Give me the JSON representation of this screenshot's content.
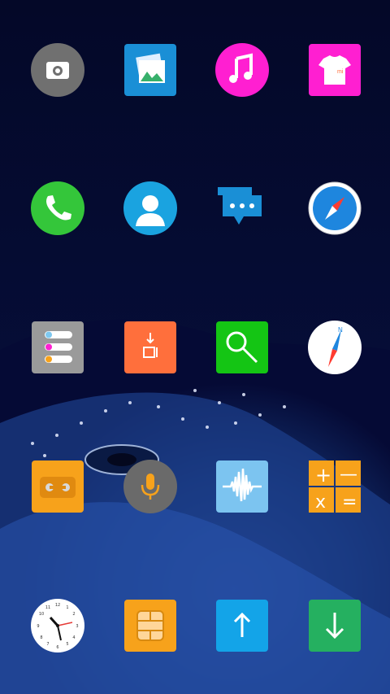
{
  "screen": "home",
  "apps": [
    {
      "id": "camera",
      "icon": "camera-icon",
      "color": "#707070"
    },
    {
      "id": "gallery",
      "icon": "gallery-icon",
      "color": "#1a8fd6"
    },
    {
      "id": "music",
      "icon": "music-note-icon",
      "color": "#ff1fd1"
    },
    {
      "id": "themes",
      "icon": "tshirt-icon",
      "color": "#ff1fd1"
    },
    {
      "id": "phone",
      "icon": "phone-icon",
      "color": "#34c63a"
    },
    {
      "id": "contacts",
      "icon": "contact-icon",
      "color": "#1aa3e0"
    },
    {
      "id": "messaging",
      "icon": "chat-bubbles-icon",
      "color": "#1a8fd6"
    },
    {
      "id": "browser",
      "icon": "compass-icon",
      "color": "#1e86de"
    },
    {
      "id": "settings-list",
      "icon": "list-toggle-icon",
      "color": "#9a9a9a"
    },
    {
      "id": "updater",
      "icon": "mi-download-icon",
      "color": "#ff6f3c"
    },
    {
      "id": "search",
      "icon": "magnifier-icon",
      "color": "#14c514"
    },
    {
      "id": "compass",
      "icon": "compass-needle-icon",
      "color": "#ffffff"
    },
    {
      "id": "fm-radio",
      "icon": "cassette-icon",
      "color": "#f7a21b"
    },
    {
      "id": "voice-recorder",
      "icon": "microphone-icon",
      "color": "#6a6a6a"
    },
    {
      "id": "sound-recorder",
      "icon": "waveform-icon",
      "color": "#7cc4f0"
    },
    {
      "id": "calculator",
      "icon": "calculator-icon",
      "color": "#f7a21b"
    },
    {
      "id": "clock",
      "icon": "clock-icon",
      "color": "#ffffff"
    },
    {
      "id": "sim-toolkit",
      "icon": "sim-card-icon",
      "color": "#f7a21b"
    },
    {
      "id": "upload",
      "icon": "arrow-up-icon",
      "color": "#13a4e8"
    },
    {
      "id": "download",
      "icon": "arrow-down-icon",
      "color": "#25b060"
    }
  ],
  "clock": {
    "hour_hand": "10:10 approx"
  },
  "text": {
    "mi_mark": "mi",
    "calc_plus": "+",
    "calc_minus": "—",
    "calc_times": "x",
    "calc_equals": "="
  }
}
